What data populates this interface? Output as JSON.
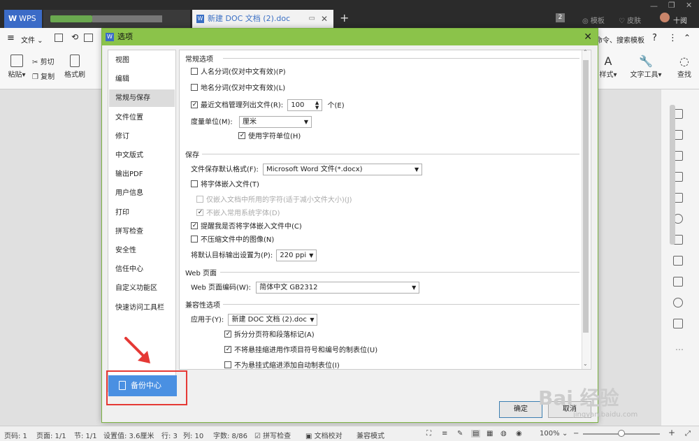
{
  "titlebar": {
    "wps_tab": "WPS",
    "doc_tab": "新建 DOC 文档 (2).doc",
    "tab_close": "✕",
    "new_tab": "+",
    "badge": "2",
    "template_btn": "模板",
    "skin_btn": "皮肤",
    "user": "十阅"
  },
  "menu": {
    "file": "文件",
    "right_items": "命令、搜索模板"
  },
  "ribbon": {
    "paste": "粘贴",
    "cut": "剪切",
    "copy": "复制",
    "format_painter": "格式刷",
    "styles": "样式",
    "text_tools": "文字工具",
    "find": "查找"
  },
  "dialog": {
    "title": "选项",
    "close": "✕",
    "nav_items": [
      "视图",
      "编辑",
      "常规与保存",
      "文件位置",
      "修订",
      "中文版式",
      "输出PDF",
      "用户信息",
      "打印",
      "拼写检查",
      "安全性",
      "信任中心",
      "自定义功能区",
      "快速访问工具栏"
    ],
    "selected_nav": "常规与保存",
    "backup_center": "备份中心",
    "sections": {
      "general": "常规选项",
      "save": "保存",
      "web": "Web 页面",
      "compat": "兼容性选项"
    },
    "general": {
      "name_segment": "人名分词(仅对中文有效)(P)",
      "place_segment": "地名分词(仅对中文有效)(L)",
      "recent_docs": "最近文档管理列出文件(R):",
      "recent_count": "100",
      "recent_unit": "个(E)",
      "measure_label": "度量单位(M):",
      "measure_value": "厘米",
      "use_char_unit": "使用字符单位(H)"
    },
    "save": {
      "default_format_label": "文件保存默认格式(F):",
      "default_format_value": "Microsoft Word 文件(*.docx)",
      "embed_fonts": "将字体嵌入文件(T)",
      "embed_used_chars": "仅嵌入文档中所用的字符(适于减小文件大小)(J)",
      "no_common_fonts": "不嵌入常用系统字体(D)",
      "remind_embed": "提醒我是否将字体嵌入文件中(C)",
      "no_compress": "不压缩文件中的图像(N)",
      "output_label": "将默认目标输出设置为(P):",
      "output_value": "220 ppi"
    },
    "web": {
      "encoding_label": "Web 页面编码(W):",
      "encoding_value": "简体中文 GB2312"
    },
    "compat": {
      "apply_label": "应用于(Y):",
      "apply_value": "新建 DOC 文档 (2).doc",
      "split_pages": "拆分分页符和段落标记(A)",
      "no_hanging": "不将悬挂缩进用作项目符号和编号的制表位(U)",
      "no_auto_tab": "不为悬挂式缩进添加自动制表位(I)"
    },
    "ok": "确定",
    "cancel": "取消"
  },
  "status": {
    "page_num": "页码: 1",
    "page_count": "页面: 1/1",
    "section": "节: 1/1",
    "position": "设置值: 3.6厘米",
    "line": "行: 3",
    "column": "列: 10",
    "words": "字数: 8/86",
    "spell": "拼写检查",
    "proofread": "文档校对",
    "compat_mode": "兼容模式",
    "zoom": "100%"
  },
  "watermark": {
    "text": "Bai 经验",
    "sub": "jingyan.baidu.com"
  },
  "colors": {
    "dialog_title": "#8bc34a",
    "backup_button": "#4a90e2",
    "highlight": "#e53935",
    "titlebar": "#2b2b2b"
  }
}
